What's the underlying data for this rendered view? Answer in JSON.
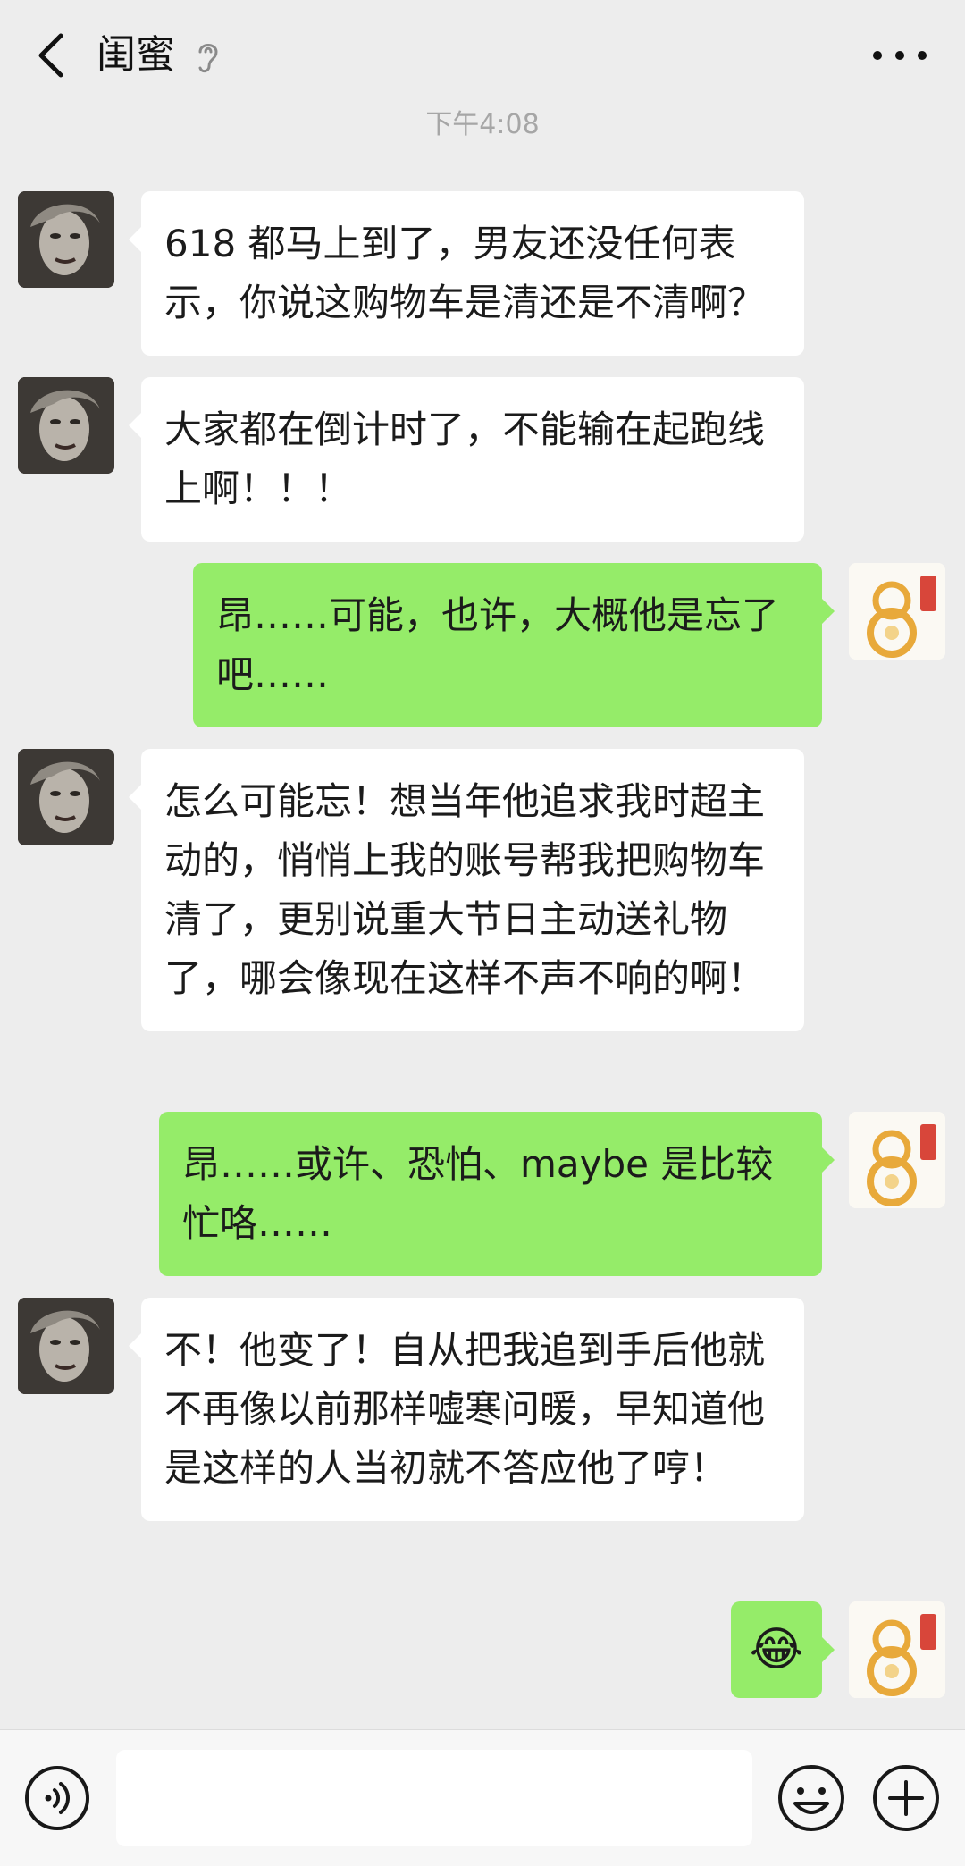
{
  "header": {
    "title": "闺蜜"
  },
  "timestamp": "下午4:08",
  "messages": [
    {
      "from": "friend",
      "text": "618 都马上到了，男友还没任何表示，你说这购物车是清还是不清啊？"
    },
    {
      "from": "friend",
      "text": "大家都在倒计时了，不能输在起跑线上啊！！！"
    },
    {
      "from": "me",
      "text": "昂……可能，也许，大概他是忘了吧……"
    },
    {
      "from": "friend",
      "text": "怎么可能忘！想当年他追求我时超主动的，悄悄上我的账号帮我把购物车清了，更别说重大节日主动送礼物了，哪会像现在这样不声不响的啊！"
    },
    {
      "from": "me",
      "text": "昂……或许、恐怕、maybe 是比较忙咯……"
    },
    {
      "from": "friend",
      "text": "不！他变了！自从把我追到手后他就不再像以前那样嘘寒问暖，早知道他是这样的人当初就不答应他了哼！"
    },
    {
      "from": "me",
      "text": "😂"
    }
  ],
  "icons": {
    "back": "chevron-left-icon",
    "muted": "ear-icon",
    "more": "more-dots-icon",
    "voice": "voice-icon",
    "emoji": "smile-icon",
    "add": "plus-icon"
  },
  "colors": {
    "background": "#ededed",
    "my_bubble": "#95ec69",
    "friend_bubble": "#ffffff"
  }
}
